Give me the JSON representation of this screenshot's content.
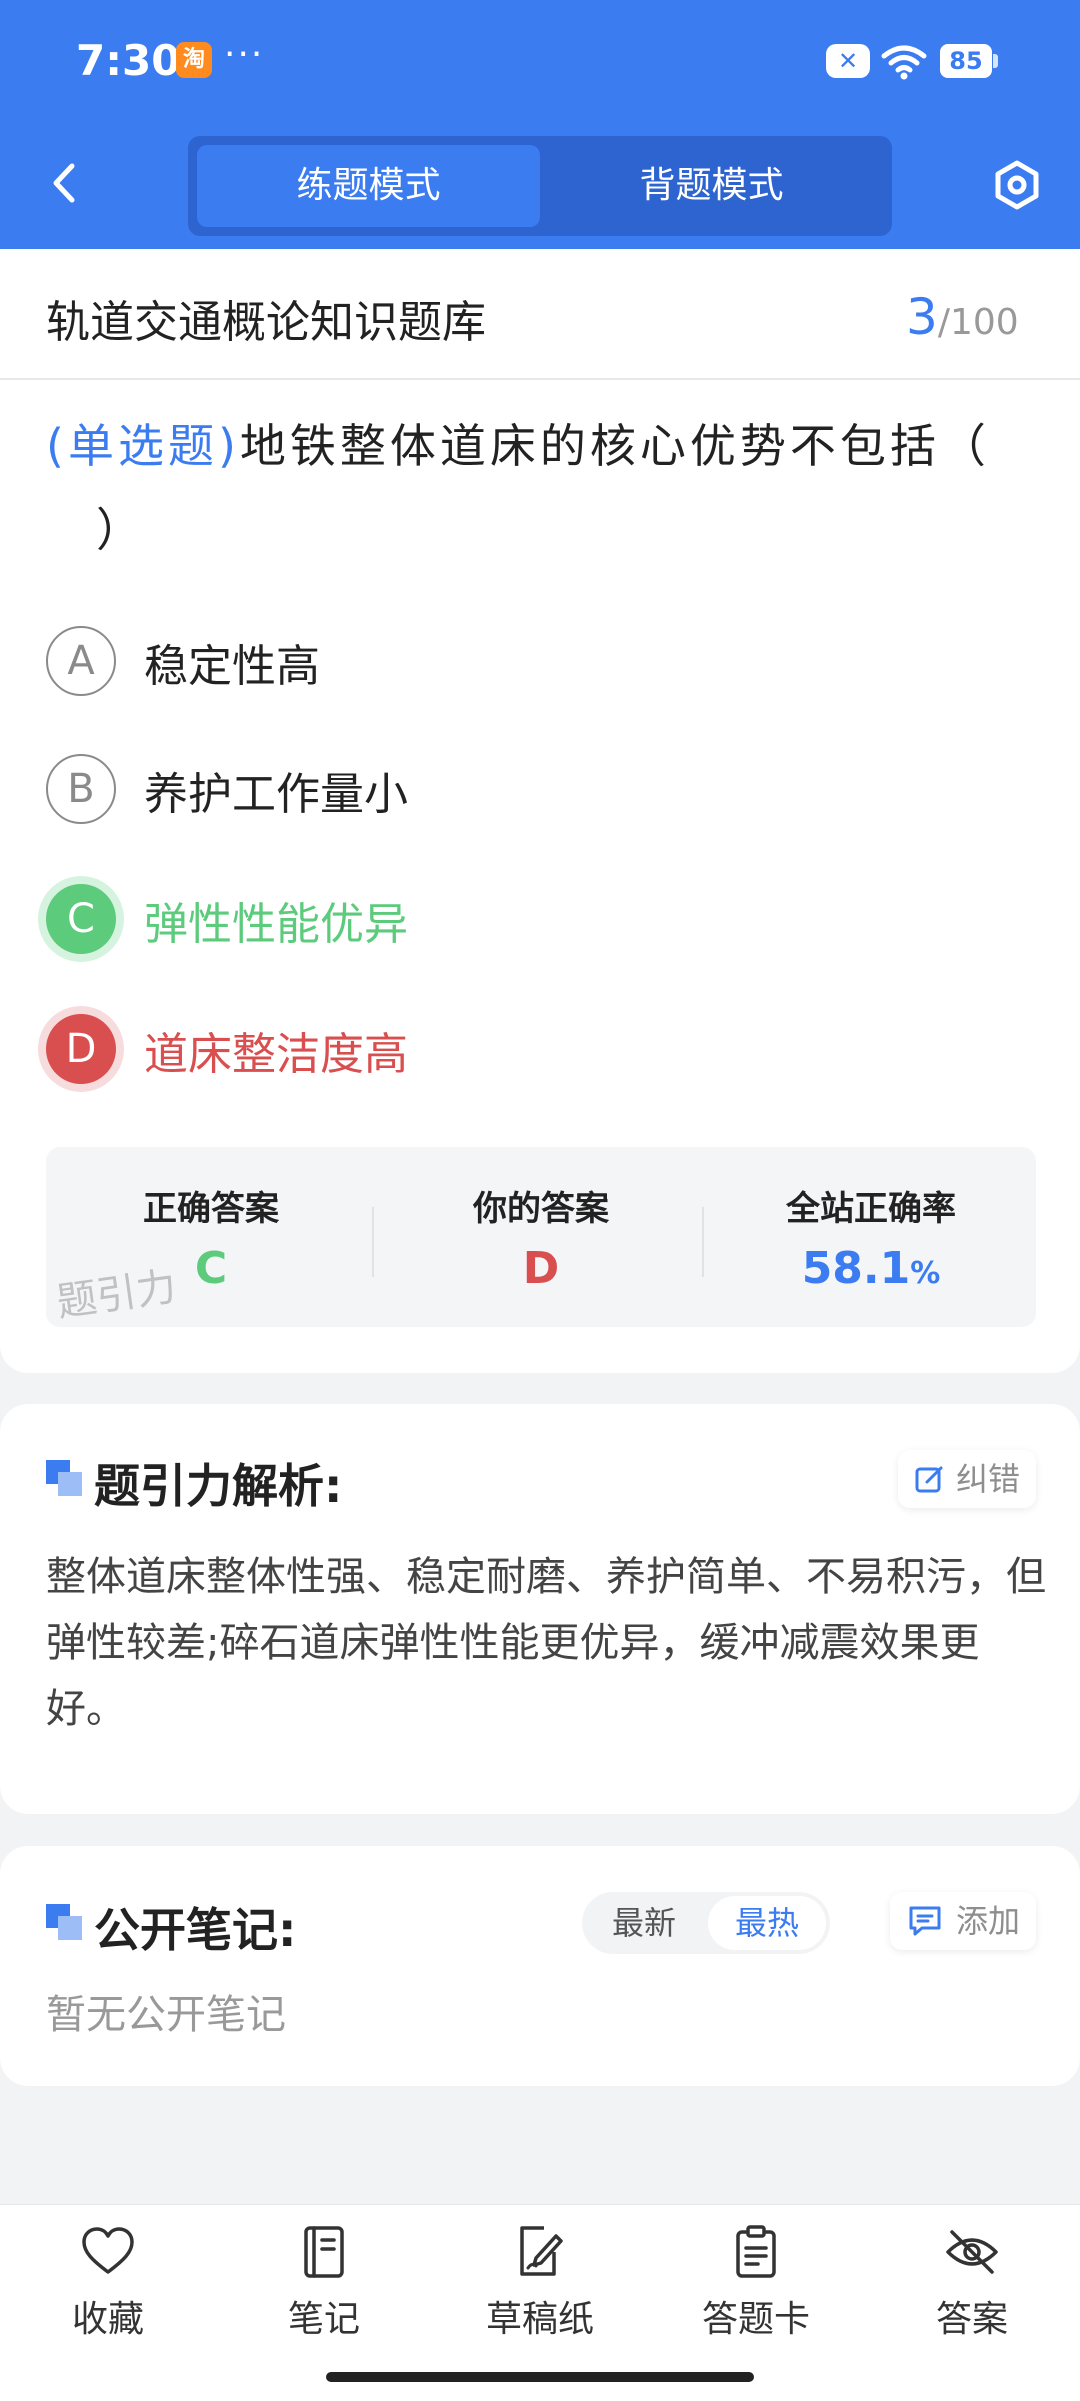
{
  "status": {
    "time": "7:30",
    "app_badge": "淘",
    "dots": "···",
    "x_icon": "✕",
    "battery": "85"
  },
  "header": {
    "modes": [
      "练题模式",
      "背题模式"
    ],
    "active_mode": "练题模式",
    "accent": "#3b7cf1"
  },
  "question": {
    "bank_title": "轨道交通概论知识题库",
    "current": "3",
    "total": "/100",
    "type": "(单选题)",
    "text": "地铁整体道床的核心优势不包括（",
    "text_end": "）",
    "options": [
      {
        "letter": "A",
        "text": "稳定性高"
      },
      {
        "letter": "B",
        "text": "养护工作量小"
      },
      {
        "letter": "C",
        "text": "弹性性能优异",
        "state": "correct"
      },
      {
        "letter": "D",
        "text": "道床整洁度高",
        "state": "wrong"
      }
    ]
  },
  "answer_summary": {
    "correct_label": "正确答案",
    "correct_value": "C",
    "yours_label": "你的答案",
    "yours_value": "D",
    "rate_label": "全站正确率",
    "rate_value": "58.1",
    "rate_unit": "%",
    "watermark": "题引力",
    "colors": {
      "correct": "#5ccb7c",
      "wrong": "#d94f4f",
      "rate": "#3b7cf1"
    }
  },
  "analysis": {
    "title": "题引力解析:",
    "report_label": "纠错",
    "text": "整体道床整体性强、稳定耐磨、养护简单、不易积污，但弹性较差;碎石道床弹性性能更优异，缓冲减震效果更好。"
  },
  "notes": {
    "title": "公开笔记:",
    "sort_options": [
      "最新",
      "最热"
    ],
    "active_sort": "最热",
    "add_label": "添加",
    "empty_text": "暂无公开笔记"
  },
  "bottom_tabs": [
    {
      "label": "收藏",
      "icon": "heart-icon"
    },
    {
      "label": "笔记",
      "icon": "notebook-icon"
    },
    {
      "label": "草稿纸",
      "icon": "draft-paper-icon"
    },
    {
      "label": "答题卡",
      "icon": "answer-card-icon"
    },
    {
      "label": "答案",
      "icon": "eye-off-icon"
    }
  ]
}
